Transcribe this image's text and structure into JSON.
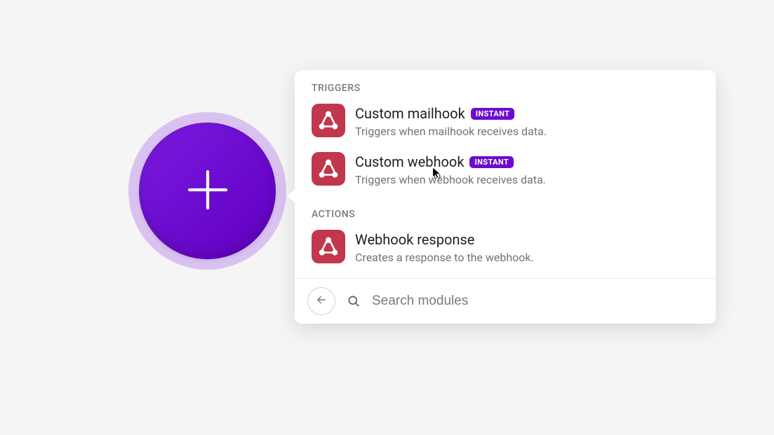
{
  "sections": {
    "triggers": {
      "label": "TRIGGERS",
      "items": [
        {
          "title": "Custom mailhook",
          "badge": "INSTANT",
          "description": "Triggers when mailhook receives data."
        },
        {
          "title": "Custom webhook",
          "badge": "INSTANT",
          "description": "Triggers when webhook receives data."
        }
      ]
    },
    "actions": {
      "label": "ACTIONS",
      "items": [
        {
          "title": "Webhook response",
          "description": "Creates a response to the webhook."
        }
      ]
    }
  },
  "search": {
    "placeholder": "Search modules"
  }
}
